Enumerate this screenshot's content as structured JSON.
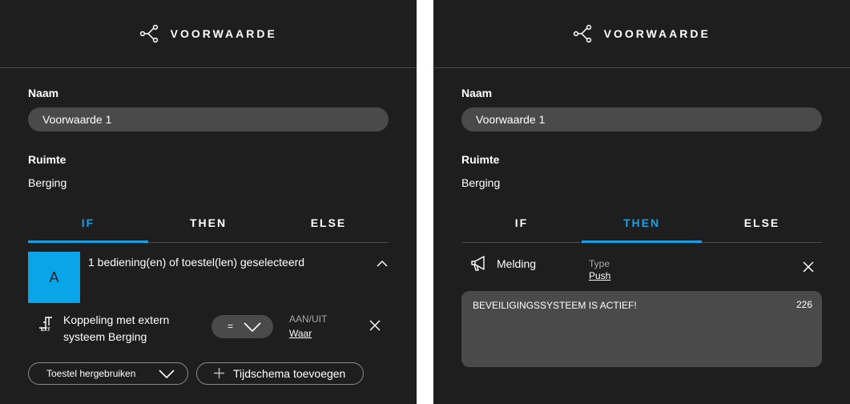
{
  "left": {
    "header_title": "VOORWAARDE",
    "naam_label": "Naam",
    "naam_value": "Voorwaarde 1",
    "ruimte_label": "Ruimte",
    "ruimte_value": "Berging",
    "tabs": [
      "IF",
      "THEN",
      "ELSE"
    ],
    "active_tab": "IF",
    "selection_avatar": "A",
    "selection_text": "1 bediening(en) of toestel(len) geselecteerd",
    "device_icon_text": "EXT",
    "device_name_line1": "Koppeling met extern",
    "device_name_line2": "systeem Berging",
    "operator": "=",
    "state_label": "AAN/UIT",
    "state_value": "Waar",
    "reuse_button": "Toestel hergebruiken",
    "schedule_button": "Tijdschema toevoegen"
  },
  "right": {
    "header_title": "VOORWAARDE",
    "naam_label": "Naam",
    "naam_value": "Voorwaarde 1",
    "ruimte_label": "Ruimte",
    "ruimte_value": "Berging",
    "tabs": [
      "IF",
      "THEN",
      "ELSE"
    ],
    "active_tab": "THEN",
    "notification_label": "Melding",
    "type_label": "Type",
    "type_value": "Push",
    "message": "BEVEILIGINGSSYSTEEM IS ACTIEF!",
    "char_count": "226"
  },
  "colors": {
    "accent": "#1c9ee0",
    "panel": "#1e1e1f",
    "field": "#4a4a4a",
    "tile": "#0aa5e8"
  }
}
